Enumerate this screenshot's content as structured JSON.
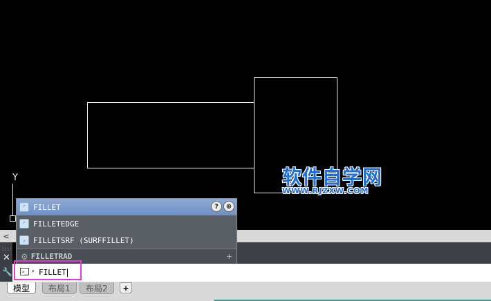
{
  "ucs": {
    "y_label": "Y"
  },
  "watermark": {
    "title": "软件自学网",
    "url": "WWW.RJZXW.COM"
  },
  "autocomplete": {
    "items": [
      {
        "label": "FILLET",
        "icon": "fillet-icon",
        "selected": true
      },
      {
        "label": "FILLETEDGE",
        "icon": "filletedge-icon",
        "selected": false
      },
      {
        "label": "FILLETSRF (SURFFILLET)",
        "icon": "filletsrf-icon",
        "selected": false
      }
    ],
    "help_symbol": "?",
    "footer_label": "FILLETRAD",
    "footer_plus": "+"
  },
  "gutter": {
    "scroll_left": "<",
    "dots": "::::",
    "close": "✕",
    "customize": "🔧"
  },
  "command": {
    "value": "FILLET",
    "prompt_icon": ">_",
    "caret": "▾"
  },
  "tabs": {
    "items": [
      "模型",
      "布局1",
      "布局2"
    ],
    "active": 0,
    "add_label": "+"
  },
  "colors": {
    "canvas": "#000000",
    "highlight": "#e23ad4",
    "watermark": "#1f6fd6"
  }
}
